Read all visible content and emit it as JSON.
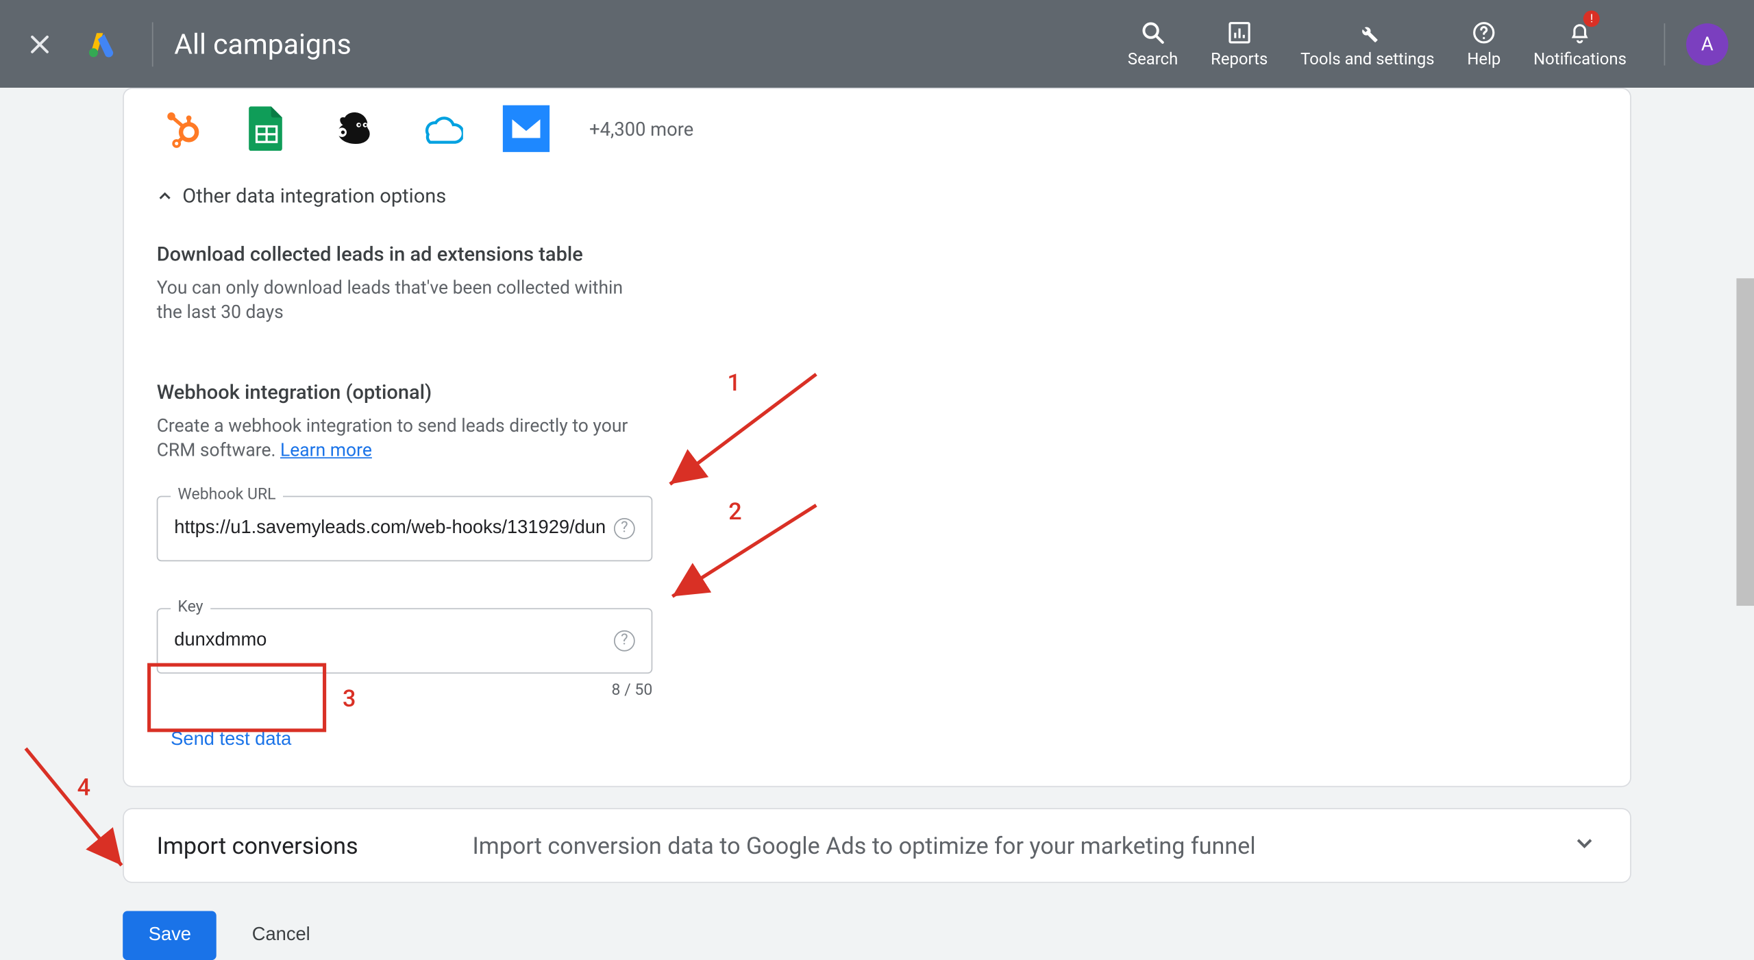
{
  "header": {
    "title": "All campaigns",
    "nav": {
      "search": "Search",
      "reports": "Reports",
      "tools": "Tools and settings",
      "help": "Help",
      "notifications": "Notifications"
    },
    "avatar_initial": "A",
    "notif_badge": "!"
  },
  "integrations": {
    "more_text": "+4,300 more"
  },
  "other_options": {
    "label": "Other data integration options"
  },
  "download_section": {
    "heading": "Download collected leads in ad extensions table",
    "desc": "You can only download leads that've been collected within the last 30 days"
  },
  "webhook": {
    "heading": "Webhook integration (optional)",
    "desc": "Create a webhook integration to send leads directly to your CRM software. ",
    "learn_more": "Learn more",
    "url_label": "Webhook URL",
    "url_value": "https://u1.savemyleads.com/web-hooks/131929/dun",
    "key_label": "Key",
    "key_value": "dunxdmmo",
    "key_counter": "8 / 50",
    "send_test": "Send test data"
  },
  "import_conv": {
    "title": "Import conversions",
    "desc": "Import conversion data to Google Ads to optimize for your marketing funnel"
  },
  "buttons": {
    "save": "Save",
    "cancel": "Cancel"
  },
  "annotations": {
    "n1": "1",
    "n2": "2",
    "n3": "3",
    "n4": "4"
  }
}
